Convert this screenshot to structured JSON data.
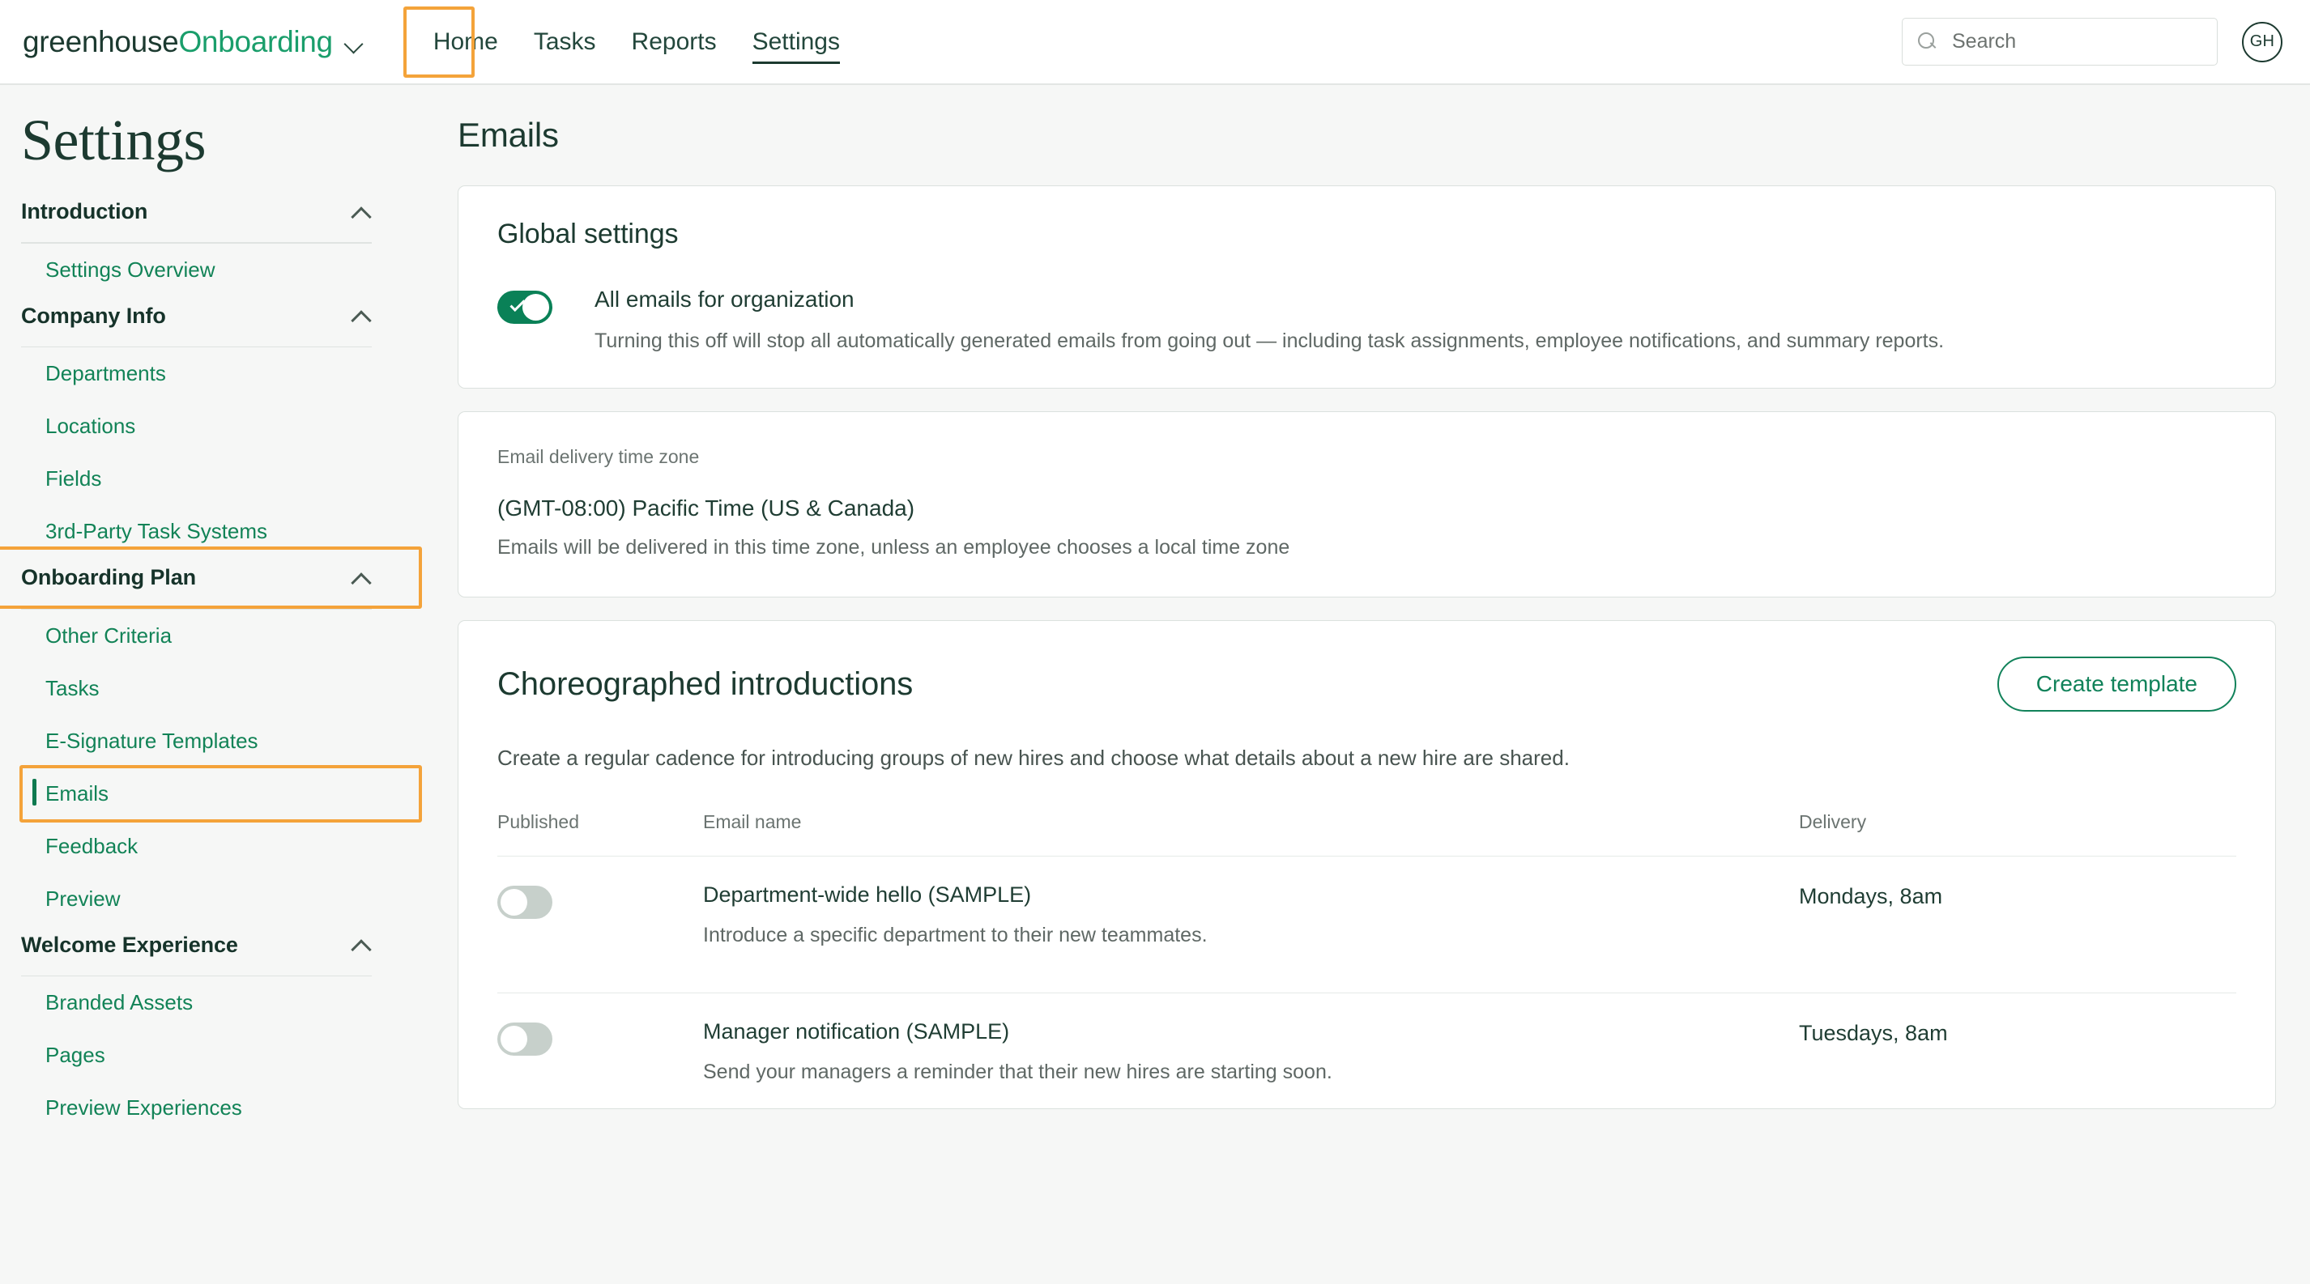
{
  "topnav": {
    "brand_primary": "greenhouse",
    "brand_secondary": "Onboarding",
    "nav_items": [
      {
        "label": "Home",
        "active": false
      },
      {
        "label": "Tasks",
        "active": false
      },
      {
        "label": "Reports",
        "active": false
      },
      {
        "label": "Settings",
        "active": true
      }
    ],
    "search": {
      "placeholder": "Search",
      "value": ""
    },
    "avatar_initials": "GH"
  },
  "sidebar": {
    "title": "Settings",
    "groups": [
      {
        "label": "Introduction",
        "expanded": true,
        "highlighted": false,
        "items": [
          {
            "label": "Settings Overview",
            "active": false
          }
        ]
      },
      {
        "label": "Company Info",
        "expanded": true,
        "highlighted": false,
        "items": [
          {
            "label": "Departments",
            "active": false
          },
          {
            "label": "Locations",
            "active": false
          },
          {
            "label": "Fields",
            "active": false
          },
          {
            "label": "3rd-Party Task Systems",
            "active": false
          }
        ]
      },
      {
        "label": "Onboarding Plan",
        "expanded": true,
        "highlighted": true,
        "items": [
          {
            "label": "Other Criteria",
            "active": false
          },
          {
            "label": "Tasks",
            "active": false
          },
          {
            "label": "E-Signature Templates",
            "active": false
          },
          {
            "label": "Emails",
            "active": true,
            "highlighted": true
          },
          {
            "label": "Feedback",
            "active": false
          },
          {
            "label": "Preview",
            "active": false
          }
        ]
      },
      {
        "label": "Welcome Experience",
        "expanded": true,
        "highlighted": false,
        "items": [
          {
            "label": "Branded Assets",
            "active": false
          },
          {
            "label": "Pages",
            "active": false
          },
          {
            "label": "Preview Experiences",
            "active": false
          }
        ]
      }
    ]
  },
  "main": {
    "title": "Emails",
    "global_settings": {
      "heading": "Global settings",
      "toggle": {
        "state": "on",
        "label": "All emails for organization",
        "description": "Turning this off will stop all automatically generated emails from going out — including task assignments, employee notifications, and summary reports."
      }
    },
    "timezone": {
      "label": "Email delivery time zone",
      "value": "(GMT-08:00) Pacific Time (US & Canada)",
      "description": "Emails will be delivered in this time zone, unless an employee chooses a local time zone"
    },
    "choreographed": {
      "heading": "Choreographed introductions",
      "create_button": "Create template",
      "description": "Create a regular cadence for introducing groups of new hires and choose what details about a new hire are shared.",
      "columns": {
        "published": "Published",
        "email_name": "Email name",
        "delivery": "Delivery"
      },
      "rows": [
        {
          "published": "off",
          "name": "Department-wide hello (SAMPLE)",
          "subtitle": "Introduce a specific department to their new teammates.",
          "delivery": "Mondays, 8am"
        },
        {
          "published": "off",
          "name": "Manager notification (SAMPLE)",
          "subtitle": "Send your managers a reminder that their new hires are starting soon.",
          "delivery": "Tuesdays, 8am"
        }
      ]
    }
  },
  "colors": {
    "brand_green": "#1a9e6b",
    "link_green": "#128357",
    "dark_green": "#1c3a30",
    "toggle_on": "#0a8157",
    "toggle_off": "#c7d0cb",
    "annotation_orange": "#f4a33a",
    "page_bg": "#f6f7f6"
  }
}
